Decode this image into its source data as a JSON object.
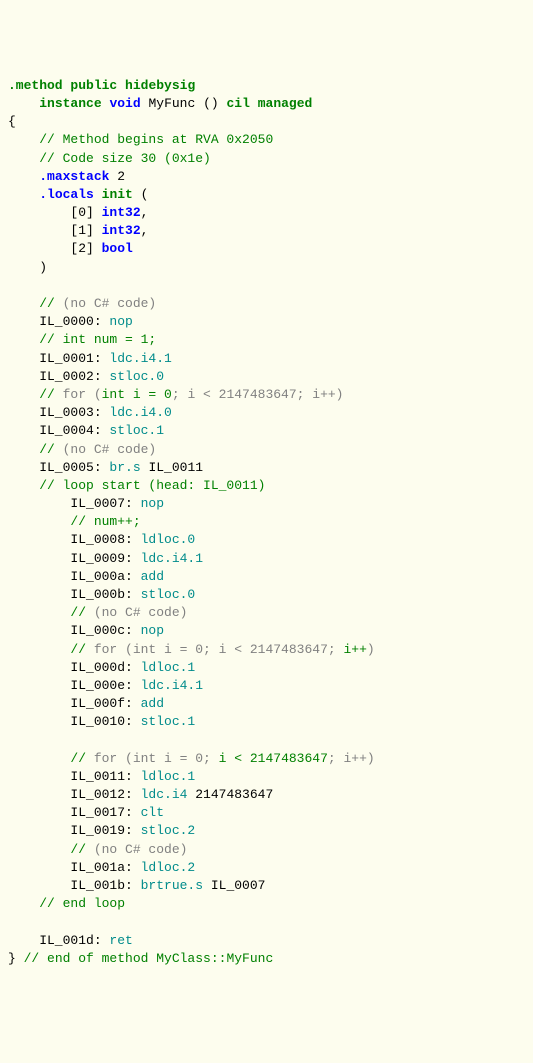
{
  "l0": {
    "a": ".method",
    "b": "public",
    "c": "hidebysig"
  },
  "l1": {
    "a": "instance",
    "b": "void",
    "c": " MyFunc () ",
    "d": "cil",
    "e": "managed"
  },
  "l2": "{",
  "l3": "    // Method begins at RVA 0x2050",
  "l4": "    // Code size 30 (0x1e)",
  "l5": {
    "a": ".maxstack",
    "b": " 2"
  },
  "l6": {
    "a": ".locals",
    "b": "init",
    "c": " ("
  },
  "l7": {
    "a": "        [0] ",
    "b": "int32",
    "c": ","
  },
  "l8": {
    "a": "        [1] ",
    "b": "int32",
    "c": ","
  },
  "l9": {
    "a": "        [2] ",
    "b": "bool"
  },
  "l10": "    )",
  "l11": {
    "a": "    // ",
    "b": "(no C# code)"
  },
  "l12": {
    "a": "    IL_0000: ",
    "b": "nop"
  },
  "l13": "    // int num = 1;",
  "l14": {
    "a": "    IL_0001: ",
    "b": "ldc.i4.1"
  },
  "l15": {
    "a": "    IL_0002: ",
    "b": "stloc.0"
  },
  "l16": {
    "a": "    // ",
    "b": "for (",
    "c": "int i = 0",
    "d": "; i < 2147483647; i++)"
  },
  "l17": {
    "a": "    IL_0003: ",
    "b": "ldc.i4.0"
  },
  "l18": {
    "a": "    IL_0004: ",
    "b": "stloc.1"
  },
  "l19": {
    "a": "    // ",
    "b": "(no C# code)"
  },
  "l20": {
    "a": "    IL_0005: ",
    "b": "br.s",
    "c": " IL_0011"
  },
  "l21": "    // loop start (head: IL_0011)",
  "l22": {
    "a": "        IL_0007: ",
    "b": "nop"
  },
  "l23": "        // num++;",
  "l24": {
    "a": "        IL_0008: ",
    "b": "ldloc.0"
  },
  "l25": {
    "a": "        IL_0009: ",
    "b": "ldc.i4.1"
  },
  "l26": {
    "a": "        IL_000a: ",
    "b": "add"
  },
  "l27": {
    "a": "        IL_000b: ",
    "b": "stloc.0"
  },
  "l28": {
    "a": "        // ",
    "b": "(no C# code)"
  },
  "l29": {
    "a": "        IL_000c: ",
    "b": "nop"
  },
  "l30": {
    "a": "        // ",
    "b": "for (int i = 0; i < 2147483647; ",
    "c": "i++",
    "d": ")"
  },
  "l31": {
    "a": "        IL_000d: ",
    "b": "ldloc.1"
  },
  "l32": {
    "a": "        IL_000e: ",
    "b": "ldc.i4.1"
  },
  "l33": {
    "a": "        IL_000f: ",
    "b": "add"
  },
  "l34": {
    "a": "        IL_0010: ",
    "b": "stloc.1"
  },
  "l35": {
    "a": "        // ",
    "b": "for (int i = 0; ",
    "c": "i < 2147483647",
    "d": "; i++)"
  },
  "l36": {
    "a": "        IL_0011: ",
    "b": "ldloc.1"
  },
  "l37": {
    "a": "        IL_0012: ",
    "b": "ldc.i4",
    "c": " 2147483647"
  },
  "l38": {
    "a": "        IL_0017: ",
    "b": "clt"
  },
  "l39": {
    "a": "        IL_0019: ",
    "b": "stloc.2"
  },
  "l40": {
    "a": "        // ",
    "b": "(no C# code)"
  },
  "l41": {
    "a": "        IL_001a: ",
    "b": "ldloc.2"
  },
  "l42": {
    "a": "        IL_001b: ",
    "b": "brtrue.s",
    "c": " IL_0007"
  },
  "l43": "    // end loop",
  "l44": {
    "a": "    IL_001d: ",
    "b": "ret"
  },
  "l45": {
    "a": "} ",
    "b": "// end of method MyClass::MyFunc"
  }
}
